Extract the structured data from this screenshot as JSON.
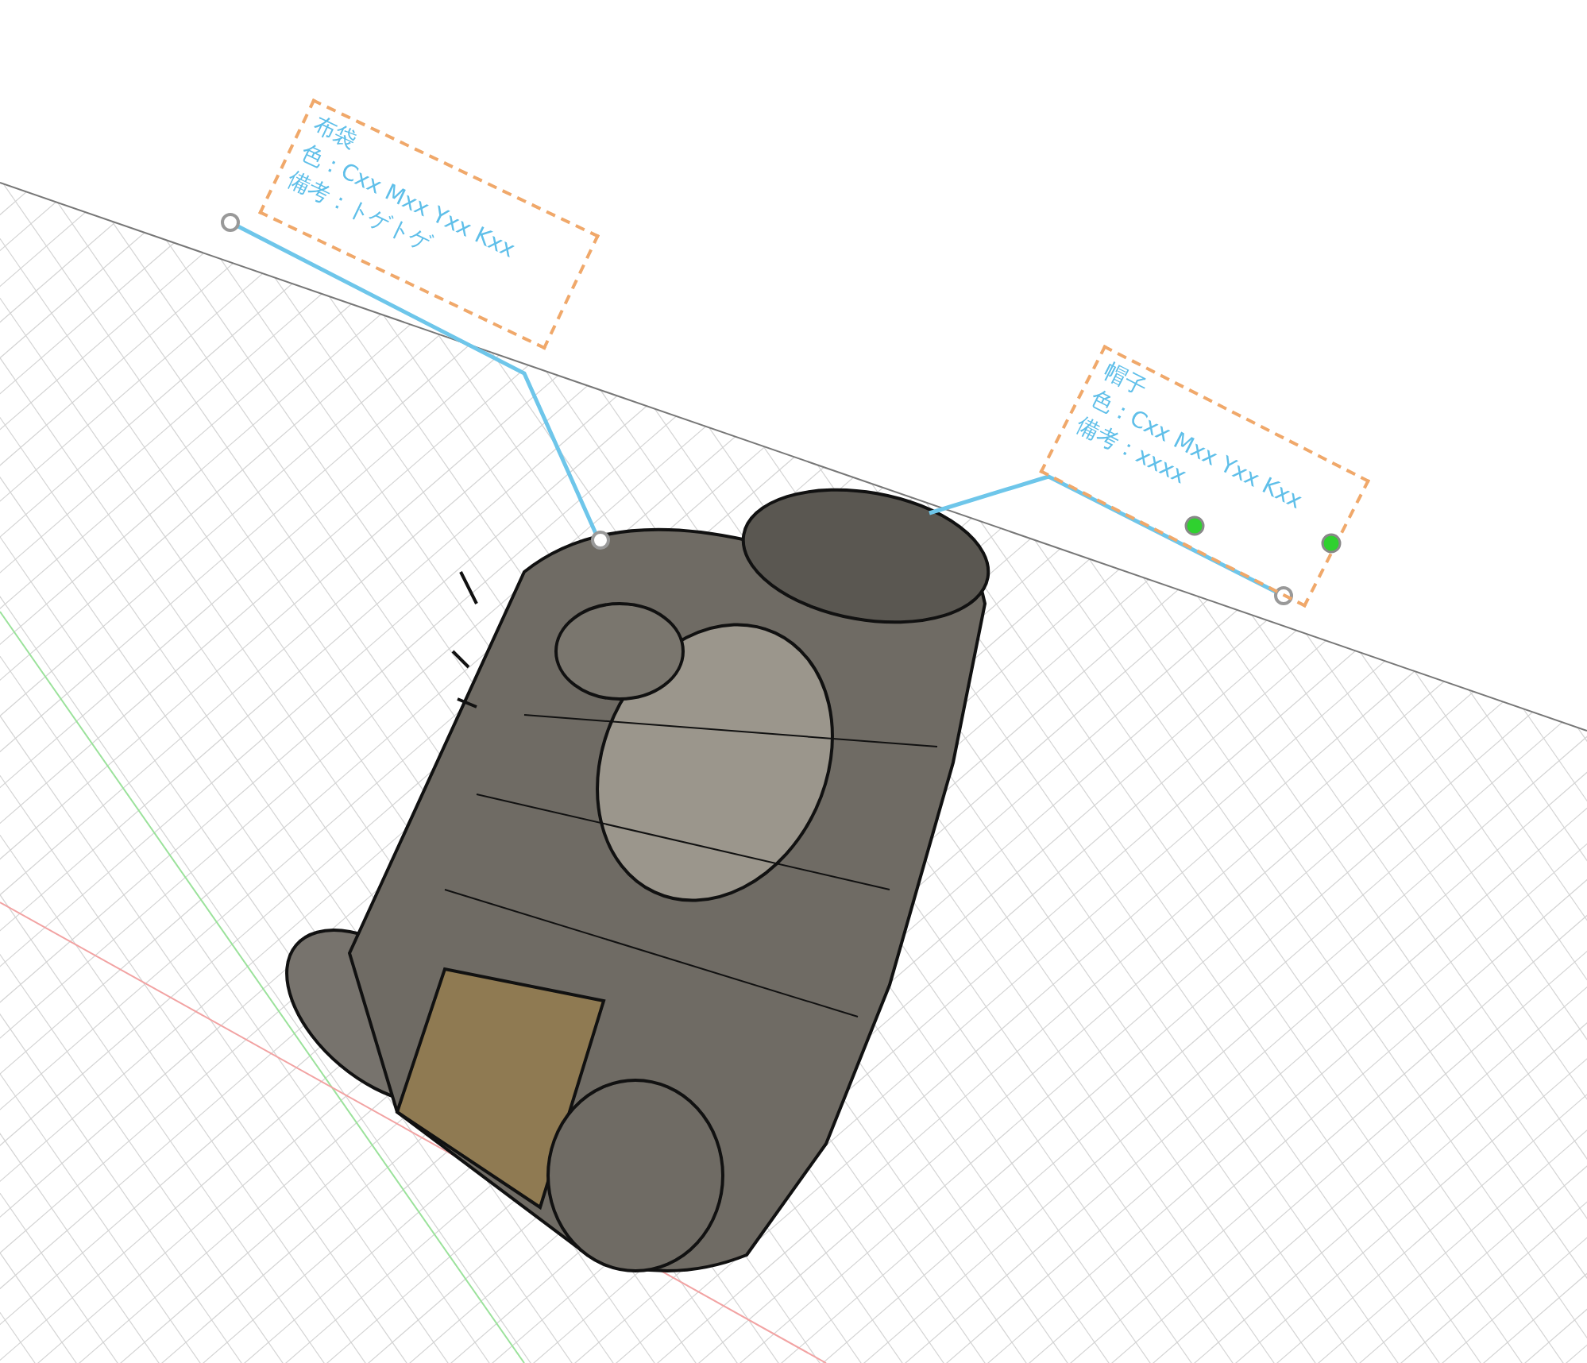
{
  "annotations": [
    {
      "title": "布袋",
      "color_spec": "色：Cxx Mxx Yxx Kxx",
      "note": "備考：トゲトゲ"
    },
    {
      "title": "帽子",
      "color_spec": "色：Cxx Mxx Yxx Kxx",
      "note": "備考：xxxx"
    }
  ]
}
